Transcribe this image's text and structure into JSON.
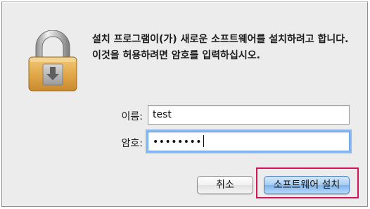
{
  "dialog": {
    "message": "설치 프로그램이(가) 새로운 소프트웨어를 설치하려고 합니다. 이것을 허용하려면 암호를 입력하십시오."
  },
  "form": {
    "name_label": "이름:",
    "name_value": "test",
    "password_label": "암호:",
    "password_masked": "••••••••"
  },
  "buttons": {
    "cancel_label": "취소",
    "install_label": "소프트웨어 설치"
  },
  "icons": {
    "lock": "lock-icon"
  },
  "colors": {
    "highlight": "#d4145a",
    "focus_ring": "#8ab9ef",
    "default_button": "#7db4ec"
  }
}
